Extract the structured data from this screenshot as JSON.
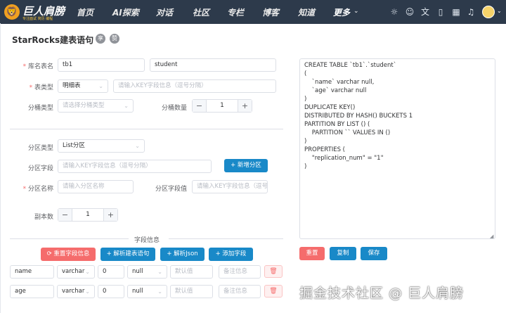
{
  "topbar": {
    "brand": "巨人肩膀",
    "brand_sub": "专注面试  简历  编程",
    "nav": [
      "首页",
      "AI探索",
      "对话",
      "社区",
      "专栏",
      "博客",
      "知道",
      "更多"
    ],
    "icons": [
      "bulb-icon",
      "robot-icon",
      "translate-icon",
      "phone-icon",
      "calendar-icon",
      "bell-icon"
    ]
  },
  "page": {
    "title": "StarRocks建表语句",
    "badges": [
      "享",
      "赞"
    ]
  },
  "form": {
    "db_table_label": "库名表名",
    "db_name": "tb1",
    "table_name": "student",
    "table_type_label": "表类型",
    "table_type": "明细表",
    "key_placeholder": "请输入KEY字段信息（逗号分隔）",
    "bucket_type_label": "分桶类型",
    "bucket_type_placeholder": "请选择分桶类型",
    "bucket_count_label": "分桶数量",
    "bucket_count": "1",
    "partition_type_label": "分区类型",
    "partition_type": "List分区",
    "partition_field_label": "分区字段",
    "partition_field_placeholder": "请输入KEY字段信息（逗号分隔）",
    "add_partition": "+ 新增分区",
    "partition_name_label": "分区名称",
    "partition_name_placeholder": "请输入分区名称",
    "partition_value_label": "分区字段值",
    "partition_value_placeholder": "请输入KEY字段信息（逗号分",
    "replica_label": "副本数",
    "replica_count": "1",
    "field_section": "字段信息"
  },
  "actions": {
    "reset": "重置字段信息",
    "parse_sql": "+ 解析建表语句",
    "parse_json": "+ 解析Json",
    "add_field": "+ 添加字段"
  },
  "fields": [
    {
      "name": "name",
      "type": "varchar",
      "length": "0",
      "nullable": "null",
      "default_ph": "默认值",
      "comment_ph": "备注信息"
    },
    {
      "name": "age",
      "type": "varchar",
      "length": "0",
      "nullable": "null",
      "default_ph": "默认值",
      "comment_ph": "备注信息"
    }
  ],
  "sql_output": "CREATE TABLE `tb1`.`student`\n(\n    `name` varchar null,\n    `age` varchar null\n)\nDUPLICATE KEY()\nDISTRIBUTED BY HASH() BUCKETS 1\nPARTITION BY LIST () (\n    PARTITION `` VALUES IN ()\n)\nPROPERTIES (\n    \"replication_num\" = \"1\"\n)",
  "output_actions": {
    "reset": "重置",
    "copy": "复制",
    "save": "保存"
  },
  "watermark": "掘金技术社区 @ 巨人肩膀",
  "colors": {
    "primary": "#1989c8",
    "danger": "#f56c6c",
    "topbar": "#2d3a4b"
  }
}
